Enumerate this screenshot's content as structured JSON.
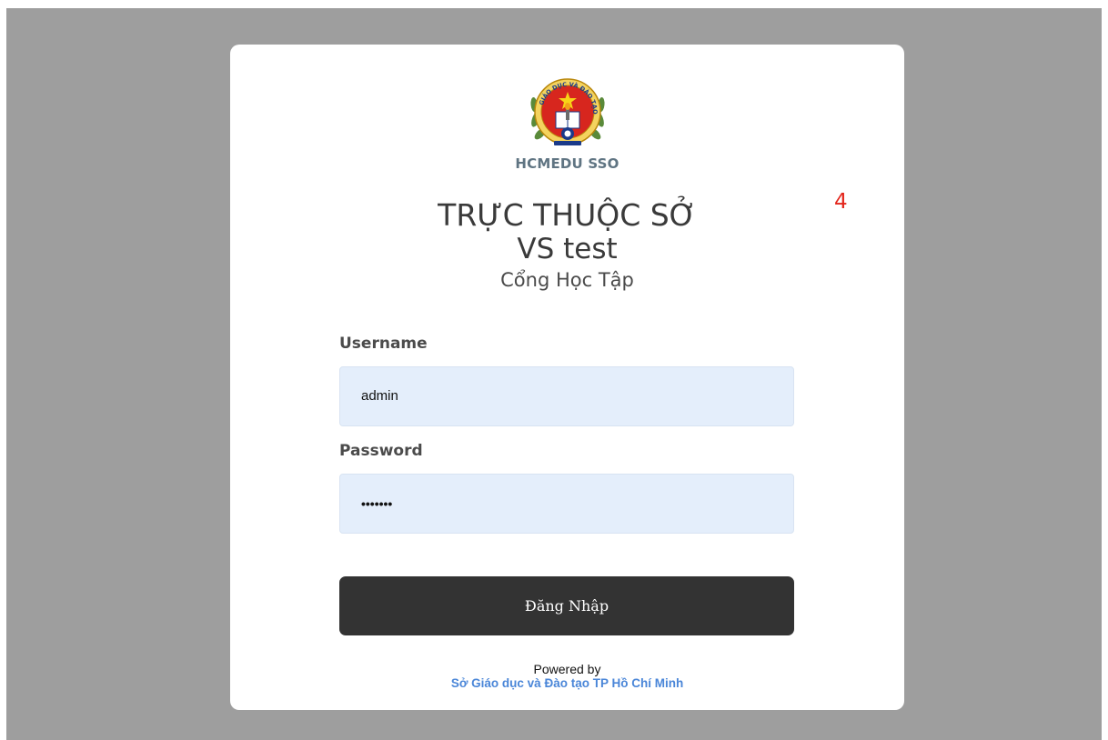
{
  "brand": {
    "name": "HCMEDU SSO",
    "logo_icon": "education-department-emblem-icon",
    "logo_ring_text": "GIÁO DỤC VÀ ĐÀO TẠO"
  },
  "notification_count": "4",
  "header": {
    "line1": "TRỰC THUỘC SỞ",
    "line2": "VS test",
    "line3": "Cổng Học Tập"
  },
  "form": {
    "username_label": "Username",
    "username_value": "admin",
    "password_label": "Password",
    "password_value": "•••••••",
    "submit_label": "Đăng Nhập"
  },
  "footer": {
    "powered_by": "Powered by",
    "organization": "Sở Giáo dục và Đào tạo TP Hồ Chí Minh"
  },
  "colors": {
    "backdrop": "#9e9e9e",
    "field_bg": "#e4eefb",
    "button_bg": "#333333",
    "link": "#4a86d8",
    "badge": "#e3261c",
    "brand_text": "#5f7482"
  }
}
